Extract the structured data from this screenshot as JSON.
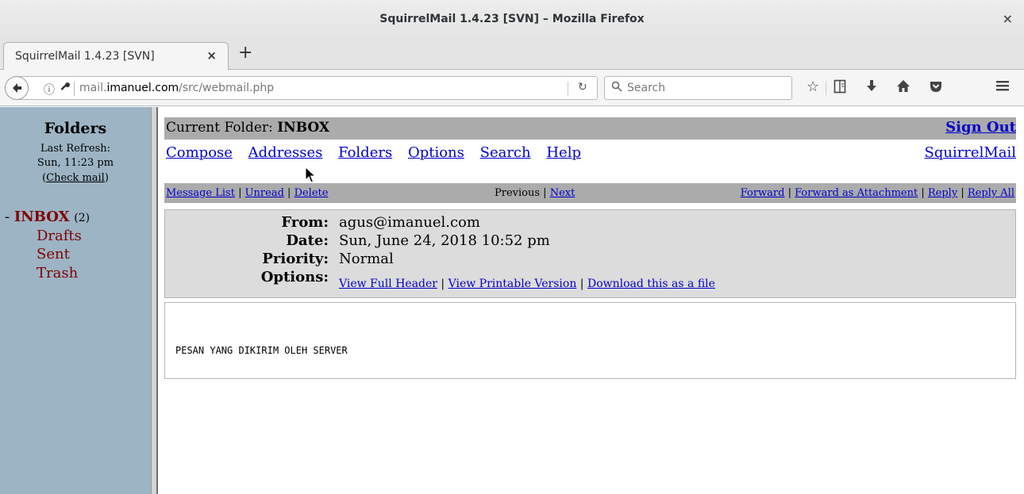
{
  "window": {
    "title": "SquirrelMail 1.4.23 [SVN] – Mozilla Firefox",
    "close_glyph": "×"
  },
  "tab": {
    "title": "SquirrelMail 1.4.23 [SVN]",
    "close_glyph": "×",
    "new_tab_glyph": "+"
  },
  "navbar": {
    "url_host": "mail.",
    "url_domain": "imanuel.com",
    "url_path": "/src/webmail.php",
    "search_placeholder": "Search",
    "icons": [
      "back-icon",
      "info-icon",
      "key-icon",
      "reload-icon",
      "search-icon",
      "bookmark-star-icon",
      "reading-list-icon",
      "download-icon",
      "home-icon",
      "pocket-icon",
      "menu-icon"
    ]
  },
  "left_pane": {
    "title": "Folders",
    "refresh_label": "Last Refresh:",
    "refresh_time": "Sun, 11:23 pm",
    "check_mail": "Check mail",
    "inbox_label": "INBOX",
    "inbox_count": "(2)",
    "folders": [
      "Drafts",
      "Sent",
      "Trash"
    ]
  },
  "main": {
    "current_folder_label": "Current Folder: ",
    "current_folder": "INBOX",
    "sign_out": "Sign Out",
    "menu": [
      "Compose",
      "Addresses",
      "Folders",
      "Options",
      "Search",
      "Help"
    ],
    "squirrelmail_link": "SquirrelMail",
    "msgnav": {
      "message_list": "Message List",
      "unread": "Unread",
      "delete": "Delete",
      "previous": "Previous",
      "next": "Next",
      "forward": "Forward",
      "forward_attachment": "Forward as Attachment",
      "reply": "Reply",
      "reply_all": "Reply All"
    },
    "header": {
      "from_label": "From:",
      "from_value": "agus@imanuel.com",
      "date_label": "Date:",
      "date_value": "Sun, June 24, 2018 10:52 pm",
      "priority_label": "Priority:",
      "priority_value": "Normal",
      "options_label": "Options:",
      "view_full_header": "View Full Header",
      "view_printable": "View Printable Version",
      "download_file": "Download this as a file"
    },
    "body": "PESAN YANG DIKIRIM OLEH SERVER"
  }
}
